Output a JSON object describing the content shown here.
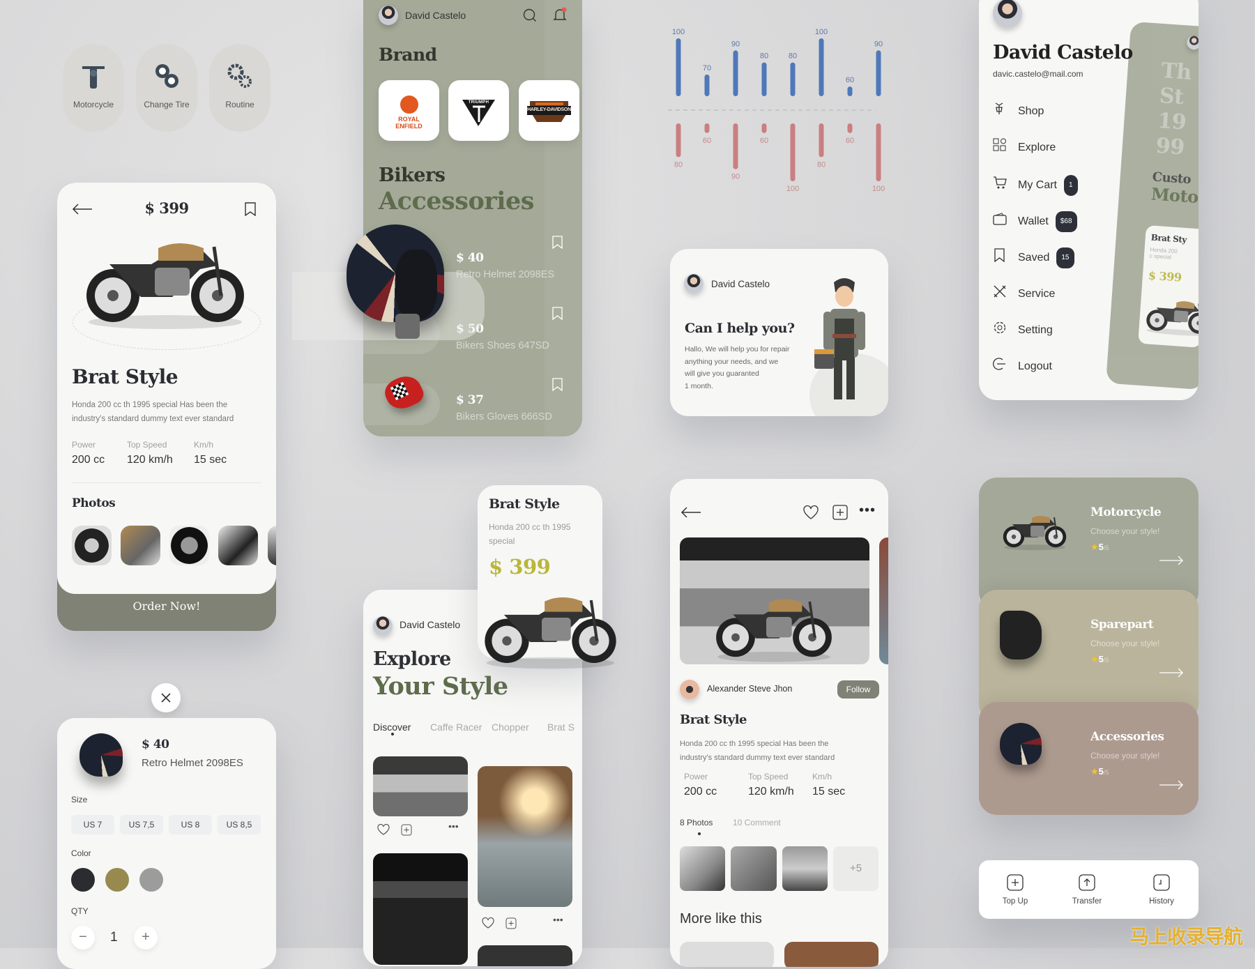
{
  "service_pills": [
    {
      "label": "Motorcycle",
      "icon": "motorcycle-icon"
    },
    {
      "label": "Change Tire",
      "icon": "tire-change-icon"
    },
    {
      "label": "Routine",
      "icon": "gears-icon"
    }
  ],
  "detail": {
    "price": "$ 399",
    "title": "Brat Style",
    "desc_line1": "Honda 200 cc th 1995 special Has been the",
    "desc_line2": "industry's standard dummy text ever standard",
    "specs": [
      {
        "label": "Power",
        "value": "200 cc"
      },
      {
        "label": "Top Speed",
        "value": "120 km/h"
      },
      {
        "label": "Km/h",
        "value": "15 sec"
      }
    ],
    "photos_label": "Photos",
    "order_label": "Order Now!"
  },
  "brand_panel": {
    "user": "David Castelo",
    "brand_title": "Brand",
    "brands": [
      "ROYAL ENFIELD",
      "TRIUMPH",
      "HARLEY-DAVIDSON"
    ],
    "heading1": "Bikers",
    "heading2": "Accessories",
    "items": [
      {
        "price": "$ 40",
        "name": "Retro Helmet 2098ES"
      },
      {
        "price": "$ 50",
        "name": "Bikers Shoes 647SD"
      },
      {
        "price": "$ 37",
        "name": "Bikers Gloves 666SD"
      }
    ]
  },
  "chart_data": {
    "type": "bar",
    "series": [
      {
        "color": "#4f78b8",
        "values": [
          100,
          70,
          90,
          80,
          80,
          100,
          60,
          90
        ]
      },
      {
        "color": "#c97f80",
        "values": [
          80,
          60,
          90,
          60,
          100,
          80,
          60,
          100
        ]
      }
    ],
    "layout": "mirrored bars around dashed baseline",
    "data_labels": true
  },
  "help_card": {
    "user": "David Castelo",
    "title": "Can I help you?",
    "lines": [
      "Hallo, We will help you for repair",
      "anything your needs, and we",
      "will give you guaranted",
      "1 month."
    ]
  },
  "menu": {
    "name": "David Castelo",
    "email": "davic.castelo@mail.com",
    "items": [
      {
        "label": "Shop",
        "icon": "shop-icon"
      },
      {
        "label": "Explore",
        "icon": "grid-icon"
      },
      {
        "label": "My Cart",
        "icon": "cart-icon",
        "badge": "1"
      },
      {
        "label": "Wallet",
        "icon": "wallet-icon",
        "badge": "$68"
      },
      {
        "label": "Saved",
        "icon": "bookmark-icon",
        "badge": "15"
      },
      {
        "label": "Service",
        "icon": "tools-icon"
      },
      {
        "label": "Setting",
        "icon": "gear-icon"
      },
      {
        "label": "Logout",
        "icon": "logout-icon"
      }
    ],
    "behind": {
      "big_text": "Th St 19 99",
      "heading1": "Custo",
      "heading2": "Moto",
      "card_title": "Brat Sty",
      "card_desc": "Honda 200 c special",
      "card_price": "$ 399"
    }
  },
  "promo": {
    "title": "Brat Style",
    "desc_line1": "Honda 200 cc th 1995",
    "desc_line2": "special",
    "price": "$ 399",
    "price_color": "#b9b63a"
  },
  "explore": {
    "user": "David Castelo",
    "heading1": "Explore",
    "heading2": "Your Style",
    "tabs": [
      "Discover",
      "Caffe Racer",
      "Chopper",
      "Brat S"
    ],
    "active_tab": "Discover"
  },
  "post": {
    "author": "Alexander Steve Jhon",
    "follow": "Follow",
    "title": "Brat Style",
    "desc_line1": "Honda 200 cc th 1995 special Has been the",
    "desc_line2": "industry's standard dummy text ever standard",
    "specs": [
      {
        "label": "Power",
        "value": "200 cc"
      },
      {
        "label": "Top Speed",
        "value": "120 km/h"
      },
      {
        "label": "Km/h",
        "value": "15 sec"
      }
    ],
    "tabs": [
      "8 Photos",
      "10 Comment"
    ],
    "more_count": "+5",
    "more_like": "More like this"
  },
  "categories": [
    {
      "title": "Motorcycle",
      "subtitle": "Choose your style!",
      "rating": "5",
      "of": "/5",
      "color": "#a4a898"
    },
    {
      "title": "Sparepart",
      "subtitle": "Choose your style!",
      "rating": "5",
      "of": "/5",
      "color": "#bab49c"
    },
    {
      "title": "Accessories",
      "subtitle": "Choose your style!",
      "rating": "5",
      "of": "/5",
      "color": "#ad9a8f"
    }
  ],
  "wallet_actions": [
    {
      "label": "Top Up",
      "icon": "plus-square-icon"
    },
    {
      "label": "Transfer",
      "icon": "upload-icon"
    },
    {
      "label": "History",
      "icon": "history-icon"
    }
  ],
  "cart": {
    "price": "$ 40",
    "name": "Retro Helmet 2098ES",
    "size_label": "Size",
    "sizes": [
      "US 7",
      "US 7,5",
      "US 8",
      "US 8,5"
    ],
    "color_label": "Color",
    "colors": [
      "#2b2c30",
      "#978a4f",
      "#9c9c9c"
    ],
    "qty_label": "QTY",
    "qty": "1"
  },
  "watermark": "马上收录导航"
}
